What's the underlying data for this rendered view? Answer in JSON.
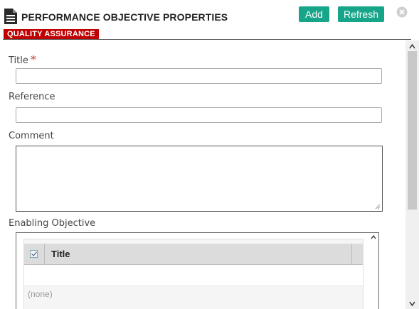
{
  "header": {
    "title": "PERFORMANCE OBJECTIVE PROPERTIES",
    "badge": "QUALITY ASSURANCE",
    "add_label": "Add",
    "refresh_label": "Refresh"
  },
  "form": {
    "title_label": "Title",
    "required_mark": "*",
    "title_value": "",
    "reference_label": "Reference",
    "reference_value": "",
    "comment_label": "Comment",
    "comment_value": "",
    "enabling_objective_label": "Enabling Objective"
  },
  "grid": {
    "columns": [
      "Title"
    ],
    "empty_text": "(none)"
  },
  "colors": {
    "accent": "#17a589",
    "badge": "#c00000",
    "required": "#c0392b"
  },
  "icons": [
    "document-icon",
    "close-icon",
    "resize-grip-icon",
    "scroll-up-icon",
    "scroll-down-icon"
  ]
}
